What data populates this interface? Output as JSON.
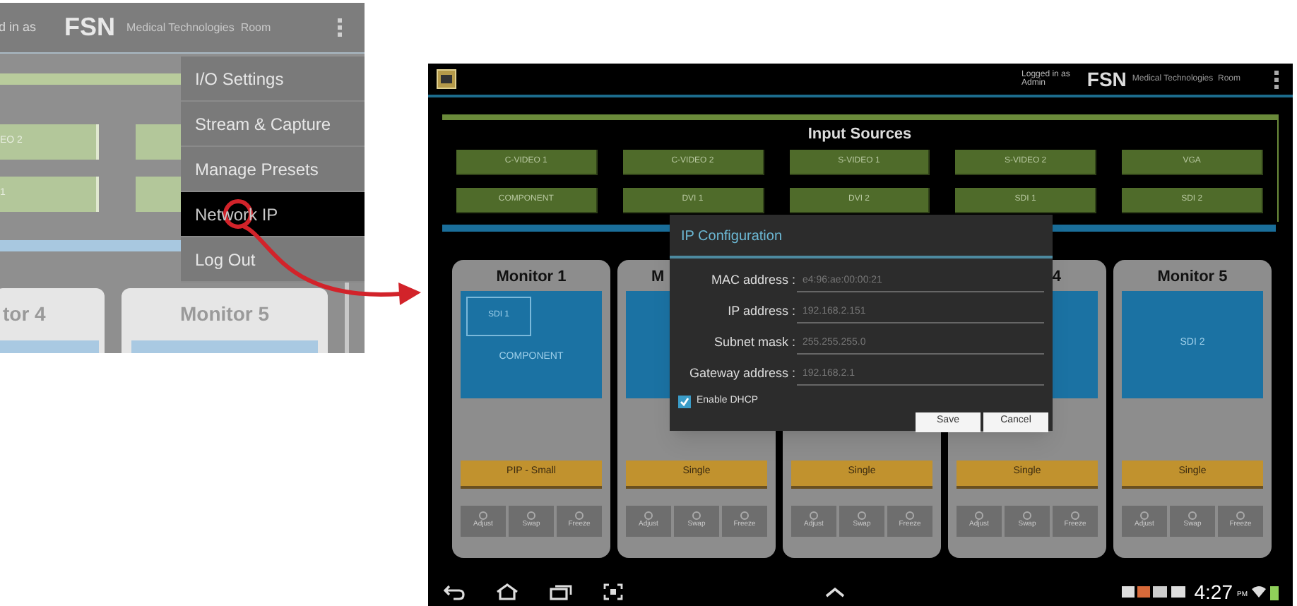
{
  "left_inset": {
    "header": {
      "login_text": "d in as",
      "logo": "FSN",
      "subtitle": "Medical Technologies  Room"
    },
    "source_fragments": [
      "EO 2",
      "1"
    ],
    "monitor_titles": [
      "tor 4",
      "Monitor 5"
    ],
    "menu": [
      {
        "label": "I/O Settings",
        "selected": false
      },
      {
        "label": "Stream & Capture",
        "selected": false
      },
      {
        "label": "Manage Presets",
        "selected": false
      },
      {
        "label": "Network IP",
        "selected": true
      },
      {
        "label": "Log Out",
        "selected": false
      }
    ]
  },
  "screen": {
    "header": {
      "login_label": "Logged in as",
      "user": "Admin",
      "logo": "FSN",
      "subtitle": "Medical Technologies  Room"
    },
    "input_sources": {
      "title": "Input Sources",
      "buttons": [
        "C-VIDEO 1",
        "C-VIDEO 2",
        "S-VIDEO 1",
        "S-VIDEO 2",
        "VGA",
        "COMPONENT",
        "DVI 1",
        "DVI 2",
        "SDI 1",
        "SDI 2"
      ]
    },
    "monitors": [
      {
        "title": "Monitor 1",
        "pip_source": "SDI 1",
        "main_source": "COMPONENT",
        "mode": "PIP - Small",
        "controls": [
          "Adjust",
          "Swap",
          "Freeze"
        ]
      },
      {
        "title": "M",
        "mode": "Single",
        "controls": [
          "Adjust",
          "Swap",
          "Freeze"
        ]
      },
      {
        "mode": "Single",
        "controls": [
          "Adjust",
          "Swap",
          "Freeze"
        ]
      },
      {
        "title": "4",
        "mode": "Single",
        "controls": [
          "Adjust",
          "Swap",
          "Freeze"
        ]
      },
      {
        "title": "Monitor 5",
        "main_source": "SDI 2",
        "mode": "Single",
        "controls": [
          "Adjust",
          "Swap",
          "Freeze"
        ]
      }
    ],
    "dialog": {
      "title": "IP Configuration",
      "fields": [
        {
          "label": "MAC address :",
          "value": "e4:96:ae:00:00:21"
        },
        {
          "label": "IP address :",
          "value": "192.168.2.151"
        },
        {
          "label": "Subnet mask :",
          "value": "255.255.255.0"
        },
        {
          "label": "Gateway address :",
          "value": "192.168.2.1"
        }
      ],
      "checkbox": {
        "label": "Enable DHCP",
        "checked": true
      },
      "buttons": [
        "Save",
        "Cancel"
      ]
    },
    "status_bar": {
      "time": "4:27",
      "ampm": "PM"
    }
  }
}
